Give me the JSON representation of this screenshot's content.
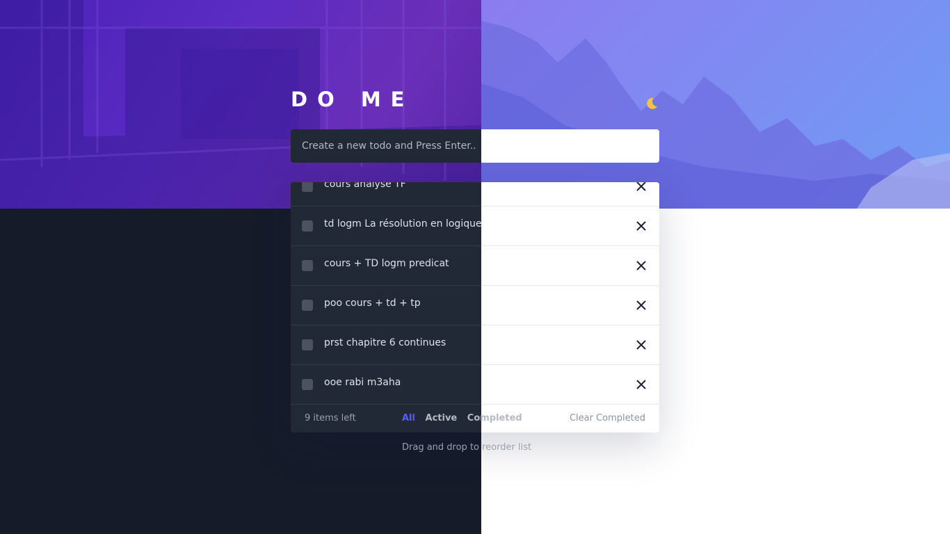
{
  "app": {
    "title": "DO ME",
    "theme_icon": "moon-icon",
    "colors": {
      "accent": "#5a5ef0",
      "dark_bg": "#151b29",
      "dark_panel": "#212936",
      "moon": "#f5c342"
    }
  },
  "new_todo": {
    "placeholder": "Create a new todo and Press Enter..",
    "value": ""
  },
  "todos": [
    {
      "text": "cours analyse TF",
      "completed": false
    },
    {
      "text": "td logm La résolution en logique",
      "completed": false
    },
    {
      "text": "cours + TD logm predicat",
      "completed": false
    },
    {
      "text": "poo cours + td + tp",
      "completed": false
    },
    {
      "text": "prst chapitre 6 continues",
      "completed": false
    },
    {
      "text": "ooe rabi m3aha",
      "completed": false
    }
  ],
  "footer": {
    "items_left": "9 items left",
    "filter_all": "All",
    "filter_active": "Active",
    "filter_completed": "Completed",
    "clear_completed": "Clear Completed"
  },
  "hint": "Drag and drop to reorder list"
}
